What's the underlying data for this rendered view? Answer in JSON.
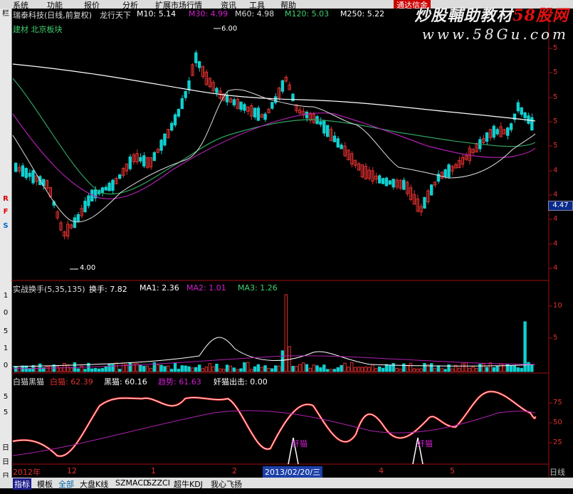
{
  "menu": {
    "items": [
      "系统",
      "功能",
      "报价",
      "分析",
      "扩展市场行情",
      "资讯",
      "工具",
      "帮助"
    ],
    "promo": "通达信金"
  },
  "watermark": {
    "line1_a": "炒股輔助教材",
    "line1_b": "58股网",
    "line2": "www.58Gu.com"
  },
  "price_panel": {
    "title": "瑞泰科技(日线,前复权)",
    "indicator": "龙行天下",
    "m10": "M10: 5.14",
    "m30": "M30: 4.99",
    "m60": "M60: 4.98",
    "m120": "M120: 5.03",
    "m250": "M250: 5.22",
    "sector": "建材 北京板块",
    "high_mark": "6.00",
    "low_mark": "4.00",
    "current_price": "4.47",
    "axis_labels": [
      "5",
      "5",
      "5",
      "5",
      "5",
      "4",
      "4",
      "4",
      "4",
      "4"
    ]
  },
  "turnover_panel": {
    "title": "实战换手(5,35,135)",
    "huanshou": "换手: 7.82",
    "ma1": "MA1: 2.36",
    "ma2": "MA2: 1.01",
    "ma3": "MA3: 1.26",
    "axis_labels": [
      "10",
      "5"
    ]
  },
  "cat_panel": {
    "title": "白猫黑猫",
    "white": "白猫: 62.39",
    "black": "黑猫: 60.16",
    "trend": "趋势: 61.63",
    "traitor": "奸猫出击: 0.00",
    "signal_label": "奸猫",
    "axis_labels": [
      "75",
      "50",
      "25"
    ]
  },
  "time_axis": {
    "labels": [
      "2012年",
      "12",
      "1",
      "2",
      "2013/02/20/三",
      "4",
      "5"
    ],
    "right": "日线"
  },
  "bottom_tabs": [
    "指标",
    "模板",
    "全部",
    "大盘K线",
    "SZMACD",
    "SZZCI",
    "超牛KDJ",
    "我心飞扬"
  ],
  "left_toolbar": [
    "栏",
    "R",
    "F",
    "S",
    "1",
    "0",
    "5",
    "1",
    "0",
    "5",
    "5",
    "日",
    "日",
    "日",
    "日"
  ],
  "colors": {
    "background": "#000000",
    "up": "#e03030",
    "down": "#10d0d0",
    "ma_white": "#ffffff",
    "ma_magenta": "#c020c0",
    "ma_green": "#40c060",
    "axis": "#e03030"
  }
}
